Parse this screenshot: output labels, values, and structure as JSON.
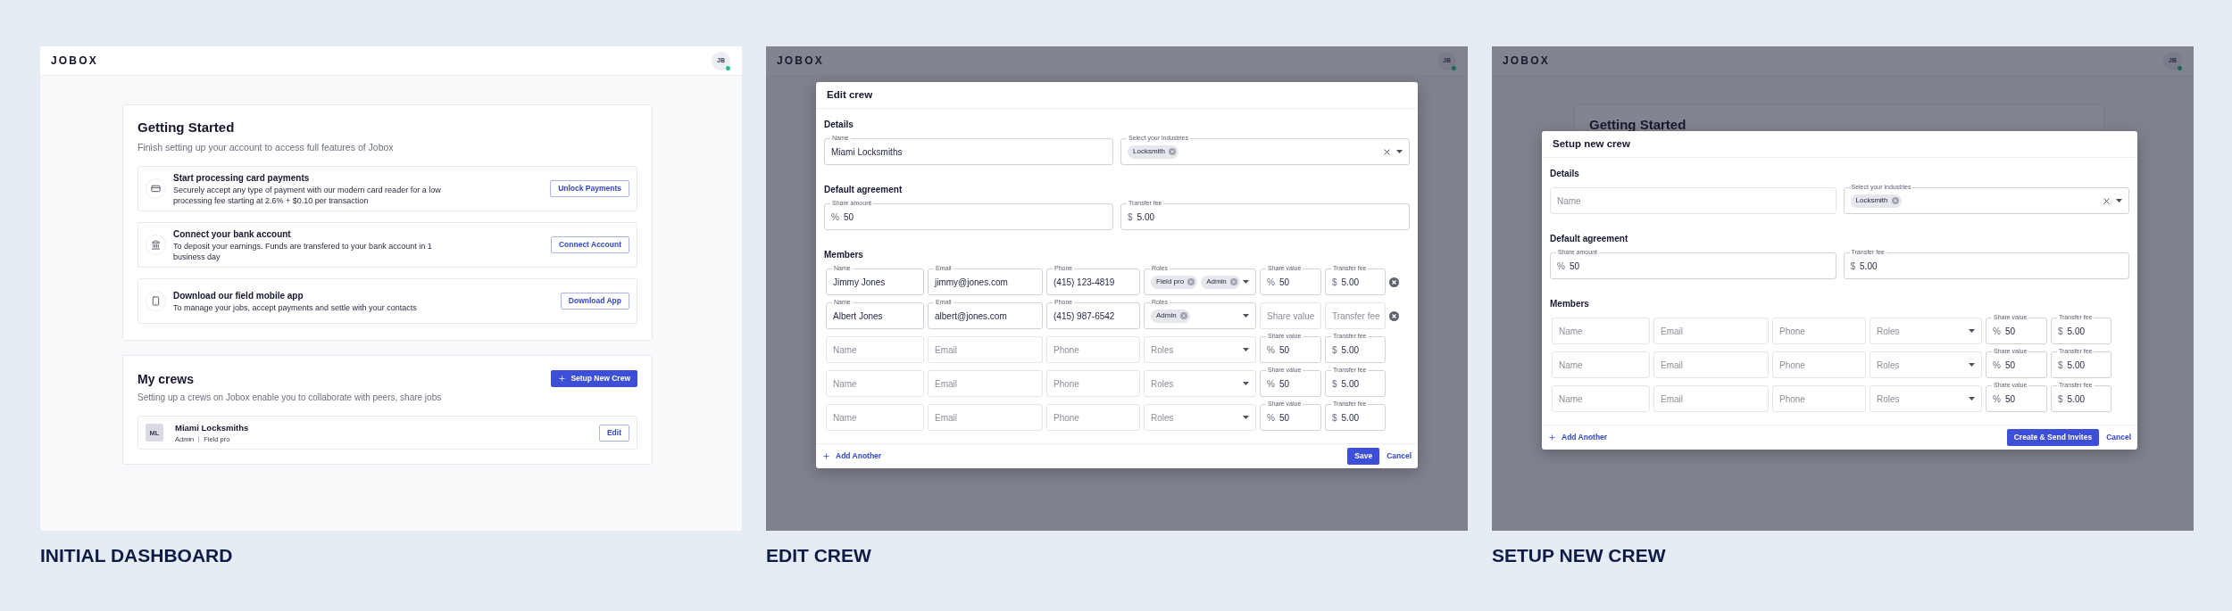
{
  "panels": [
    {
      "kind": "dashboard",
      "caption": "INITIAL DASHBOARD",
      "header": {
        "logo": "JOBOX",
        "avatar": "JB",
        "online": true
      },
      "getting_started": {
        "title": "Getting Started",
        "subtitle": "Finish setting up your account to access full features of Jobox",
        "steps": [
          {
            "title": "Start processing card payments",
            "description": "Securely accept any type of payment with our modern card reader for a low processing fee starting at 2.6% + $0.10 per transaction",
            "button": "Unlock Payments"
          },
          {
            "title": "Connect your bank account",
            "description": "To deposit your earnings. Funds are transfered to your bank account in 1 business day",
            "button": "Connect Account"
          },
          {
            "title": "Download our field mobile app",
            "description": "To manage your jobs, accept payments and settle with your contacts",
            "button": "Download App"
          }
        ]
      },
      "crews": {
        "title": "My crews",
        "subtitle": "Setting up a crews on Jobox enable you to collaborate with peers, share jobs",
        "button": "Setup New Crew",
        "items": [
          {
            "initials": "ML",
            "name": "Miami Locksmiths",
            "roles": [
              "Admin",
              "Field pro"
            ],
            "button": "Edit"
          }
        ]
      }
    },
    {
      "kind": "modal",
      "caption": "EDIT CREW",
      "header": {
        "logo": "JOBOX",
        "avatar": "JB",
        "online": true
      },
      "modal": {
        "kind": "edit",
        "title": "Edit crew",
        "details": {
          "heading": "Details",
          "name": {
            "label": "Name",
            "value": "Miami Locksmiths"
          },
          "industries": {
            "label": "Select your industries",
            "tags": [
              "Locksmith"
            ]
          }
        },
        "agreement": {
          "heading": "Default agreement",
          "share": {
            "label": "Share amount",
            "prefix": "%",
            "value": "50"
          },
          "fee": {
            "label": "Transfer fee",
            "prefix": "$",
            "value": "5.00"
          }
        },
        "members": {
          "heading": "Members",
          "rows": [
            {
              "name": {
                "label": "Name",
                "value": "Jimmy Jones"
              },
              "email": {
                "label": "Email",
                "value": "jimmy@jones.com"
              },
              "phone": {
                "label": "Phone",
                "value": "(415) 123-4819"
              },
              "roles": {
                "label": "Roles",
                "tags": [
                  "Field pro",
                  "Admin"
                ]
              },
              "share": {
                "label": "Share value",
                "prefix": "%",
                "value": "50"
              },
              "fee": {
                "label": "Transfer fee",
                "prefix": "$",
                "value": "5.00"
              },
              "removable": true
            },
            {
              "name": {
                "label": "Name",
                "value": "Albert Jones"
              },
              "email": {
                "label": "Email",
                "value": "albert@jones.com"
              },
              "phone": {
                "label": "Phone",
                "value": "(415) 987-6542"
              },
              "roles": {
                "label": "Roles",
                "tags": [
                  "Admin"
                ]
              },
              "share": {
                "placeholder": "Share value"
              },
              "fee": {
                "placeholder": "Transfer fee"
              },
              "removable": true
            },
            {
              "name": {
                "placeholder": "Name"
              },
              "email": {
                "placeholder": "Email"
              },
              "phone": {
                "placeholder": "Phone"
              },
              "roles": {
                "placeholder": "Roles"
              },
              "share": {
                "label": "Share value",
                "prefix": "%",
                "value": "50"
              },
              "fee": {
                "label": "Transfer fee",
                "prefix": "$",
                "value": "5.00"
              },
              "removable": false
            },
            {
              "name": {
                "placeholder": "Name"
              },
              "email": {
                "placeholder": "Email"
              },
              "phone": {
                "placeholder": "Phone"
              },
              "roles": {
                "placeholder": "Roles"
              },
              "share": {
                "label": "Share value",
                "prefix": "%",
                "value": "50"
              },
              "fee": {
                "label": "Transfer fee",
                "prefix": "$",
                "value": "5.00"
              },
              "removable": false
            },
            {
              "name": {
                "placeholder": "Name"
              },
              "email": {
                "placeholder": "Email"
              },
              "phone": {
                "placeholder": "Phone"
              },
              "roles": {
                "placeholder": "Roles"
              },
              "share": {
                "label": "Share value",
                "prefix": "%",
                "value": "50"
              },
              "fee": {
                "label": "Transfer fee",
                "prefix": "$",
                "value": "5.00"
              },
              "removable": false
            }
          ]
        },
        "footer": {
          "add": "Add Another",
          "submit": "Save",
          "cancel": "Cancel"
        }
      }
    },
    {
      "kind": "modal",
      "caption": "SETUP NEW CREW",
      "header": {
        "logo": "JOBOX",
        "avatar": "JB",
        "online": true
      },
      "background_title": "Getting Started",
      "modal": {
        "kind": "create",
        "title": "Setup new crew",
        "details": {
          "heading": "Details",
          "name": {
            "placeholder": "Name"
          },
          "industries": {
            "label": "Select your industries",
            "tags": [
              "Locksmith"
            ]
          }
        },
        "agreement": {
          "heading": "Default agreement",
          "share": {
            "label": "Share amount",
            "prefix": "%",
            "value": "50"
          },
          "fee": {
            "label": "Transfer fee",
            "prefix": "$",
            "value": "5.00"
          }
        },
        "members": {
          "heading": "Members",
          "rows": [
            {
              "name": {
                "placeholder": "Name"
              },
              "email": {
                "placeholder": "Email"
              },
              "phone": {
                "placeholder": "Phone"
              },
              "roles": {
                "placeholder": "Roles"
              },
              "share": {
                "label": "Share value",
                "prefix": "%",
                "value": "50"
              },
              "fee": {
                "label": "Transfer fee",
                "prefix": "$",
                "value": "5.00"
              },
              "removable": false
            },
            {
              "name": {
                "placeholder": "Name"
              },
              "email": {
                "placeholder": "Email"
              },
              "phone": {
                "placeholder": "Phone"
              },
              "roles": {
                "placeholder": "Roles"
              },
              "share": {
                "label": "Share value",
                "prefix": "%",
                "value": "50"
              },
              "fee": {
                "label": "Transfer fee",
                "prefix": "$",
                "value": "5.00"
              },
              "removable": false
            },
            {
              "name": {
                "placeholder": "Name"
              },
              "email": {
                "placeholder": "Email"
              },
              "phone": {
                "placeholder": "Phone"
              },
              "roles": {
                "placeholder": "Roles"
              },
              "share": {
                "label": "Share value",
                "prefix": "%",
                "value": "50"
              },
              "fee": {
                "label": "Transfer fee",
                "prefix": "$",
                "value": "5.00"
              },
              "removable": false
            }
          ]
        },
        "footer": {
          "add": "Add Another",
          "submit": "Create & Send Invites",
          "cancel": "Cancel"
        }
      }
    }
  ]
}
